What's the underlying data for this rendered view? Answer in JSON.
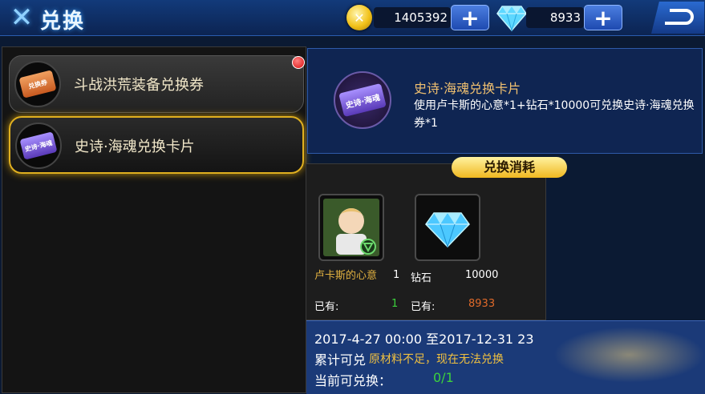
{
  "header": {
    "title": "兑换",
    "gold": "1405392",
    "diamonds": "8933"
  },
  "exchange_list": [
    {
      "label": "斗战洪荒装备兑换券",
      "icon_text": "兑换券",
      "selected": false
    },
    {
      "label": "史诗·海魂兑换卡片",
      "icon_text": "史诗·海魂",
      "selected": true
    }
  ],
  "selected_item": {
    "name": "史诗·海魂兑换卡片",
    "icon_text": "史诗·海魂",
    "description": "使用卢卡斯的心意*1+钻石*10000可兑换史诗·海魂兑换券*1"
  },
  "cost": {
    "header": "兑换消耗",
    "materials": [
      {
        "name": "卢卡斯的心意",
        "required": "1",
        "owned_label": "已有:",
        "owned": "1"
      },
      {
        "name": "钻石",
        "required": "10000",
        "owned_label": "已有:",
        "owned": "8933"
      }
    ]
  },
  "footer": {
    "date_range": "2017-4-27 00:00 至2017-12-31 23",
    "cumulative_label": "累计可兑",
    "warning": "原材料不足，现在无法兑换",
    "current_label": "当前可兑换：",
    "current_value": "0/1"
  },
  "colors": {
    "highlight": "#e0b020",
    "owned_ok": "#3cd23c",
    "owned_short": "#e06a2a"
  }
}
